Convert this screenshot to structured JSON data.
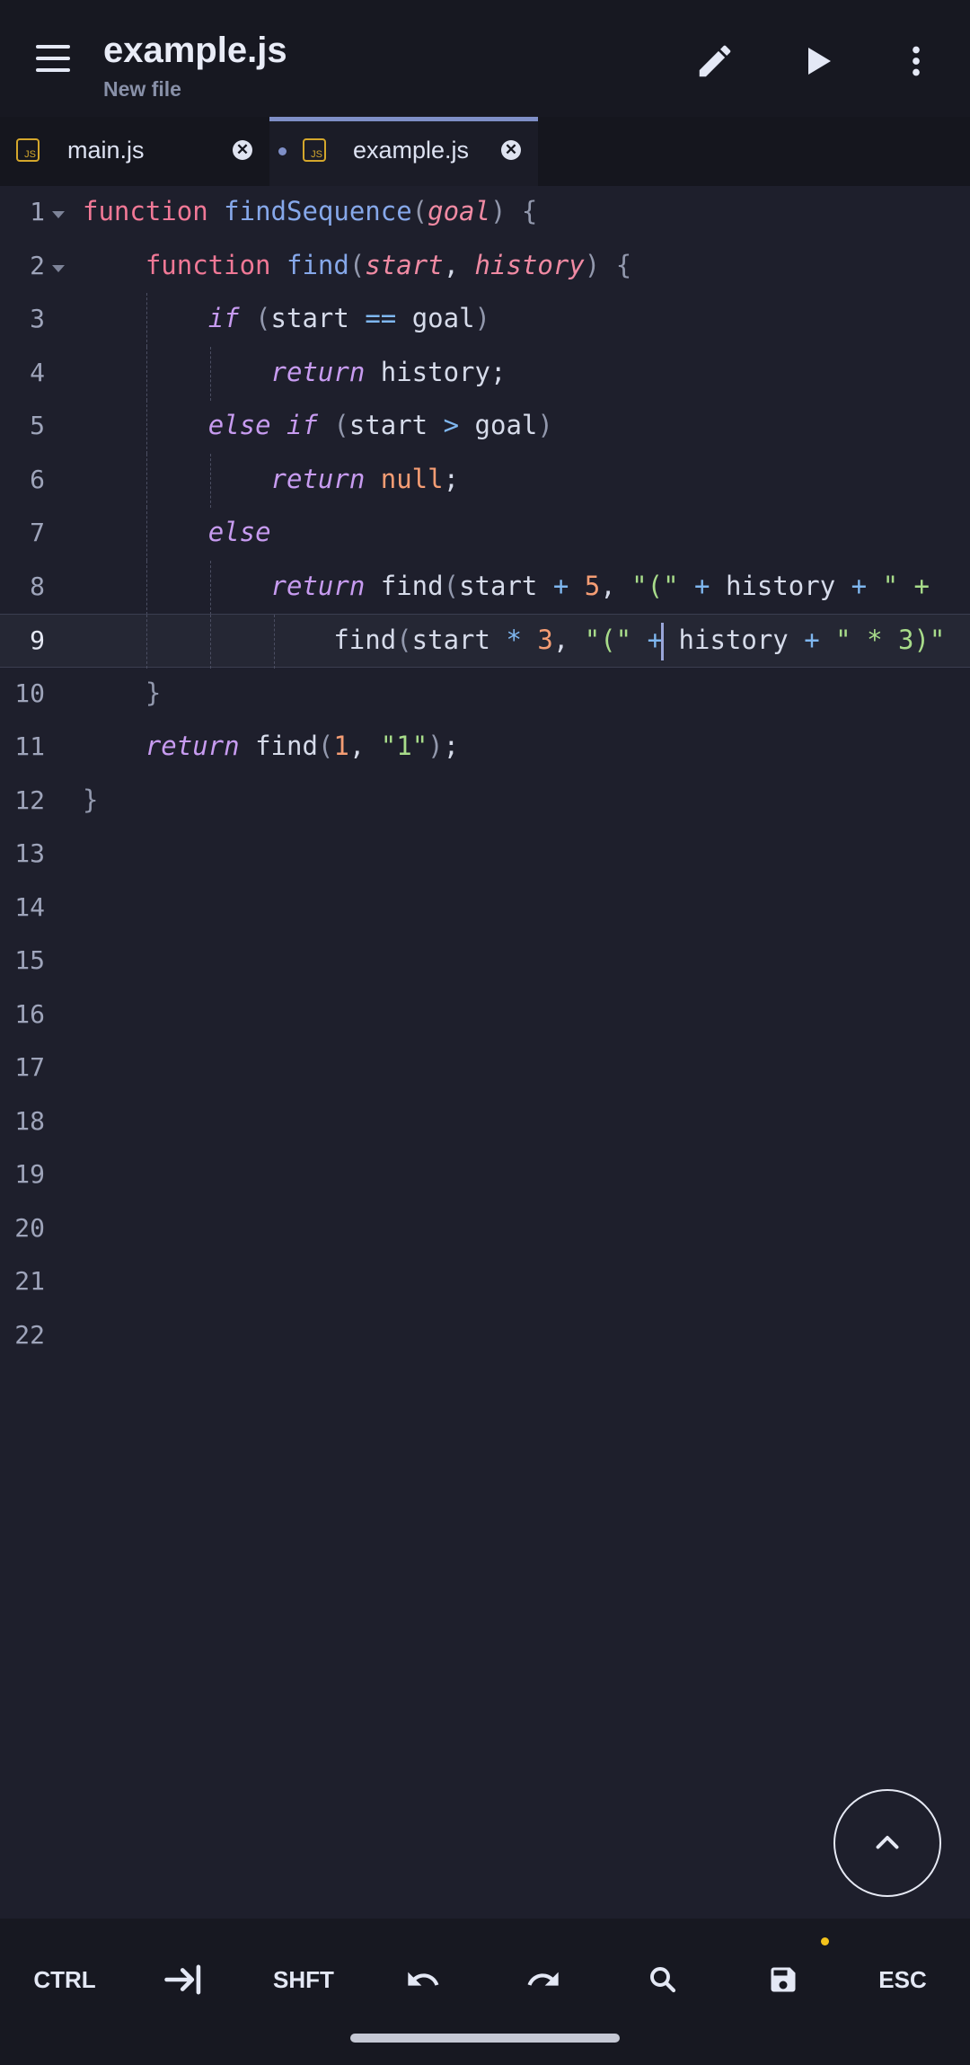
{
  "header": {
    "title": "example.js",
    "subtitle": "New file",
    "actions": [
      "menu-icon",
      "edit-icon",
      "run-icon",
      "more-icon"
    ]
  },
  "tabs": [
    {
      "label": "main.js",
      "icon": "js-file-icon",
      "active": false
    },
    {
      "label": "example.js",
      "icon": "js-file-icon",
      "active": true,
      "unsaved": true
    }
  ],
  "js_icon_text": "JS",
  "close_glyph": "✕",
  "editor": {
    "current_line": 9,
    "line_numbers": [
      "1",
      "2",
      "3",
      "4",
      "5",
      "6",
      "7",
      "8",
      "9",
      "10",
      "11",
      "12",
      "13",
      "14",
      "15",
      "16",
      "17",
      "18",
      "19",
      "20",
      "21",
      "22"
    ],
    "lines": [
      "function findSequence(goal) {",
      "    function find(start, history) {",
      "        if (start == goal)",
      "            return history;",
      "        else if (start > goal)",
      "            return null;",
      "        else",
      "            return find(start + 5, \"(\" + history + \" + ",
      "                find(start * 3, \"(\" + history + \" * 3)\"",
      "    }",
      "    return find(1, \"1\");",
      "}"
    ]
  },
  "bottombar": {
    "ctrl": "CTRL",
    "shift": "SHFT",
    "esc": "ESC",
    "icons": [
      "tab-icon",
      "undo-icon",
      "redo-icon",
      "search-icon",
      "save-icon"
    ]
  },
  "colors": {
    "background": "#1e1f2c",
    "keyword": "#f07896",
    "function": "#86a8ea",
    "string": "#a8dc8a",
    "number": "#f59d74",
    "accent": "#7f8fc7",
    "modified_dot": "#f2c21b"
  }
}
